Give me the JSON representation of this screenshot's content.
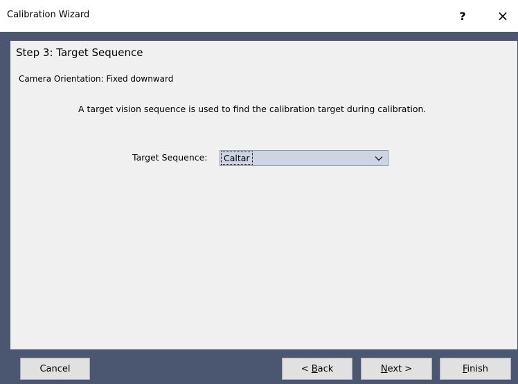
{
  "window": {
    "title": "Calibration Wizard",
    "help_label": "?",
    "close_label": "×"
  },
  "step": {
    "title": "Step 3: Target Sequence",
    "orientation": "Camera Orientation: Fixed downward",
    "description": "A target vision sequence is used to find the calibration target during calibration."
  },
  "target_sequence": {
    "label": "Target Sequence:",
    "value": "Caltar"
  },
  "buttons": {
    "cancel": "Cancel",
    "back_prefix": "< ",
    "back_accel": "B",
    "back_rest": "ack",
    "next_accel": "N",
    "next_rest": "ext >",
    "finish_accel": "F",
    "finish_rest": "inish"
  },
  "colors": {
    "frame": "#4b5670",
    "panel": "#f0f0f0",
    "select_bg": "#cdd4e4"
  }
}
